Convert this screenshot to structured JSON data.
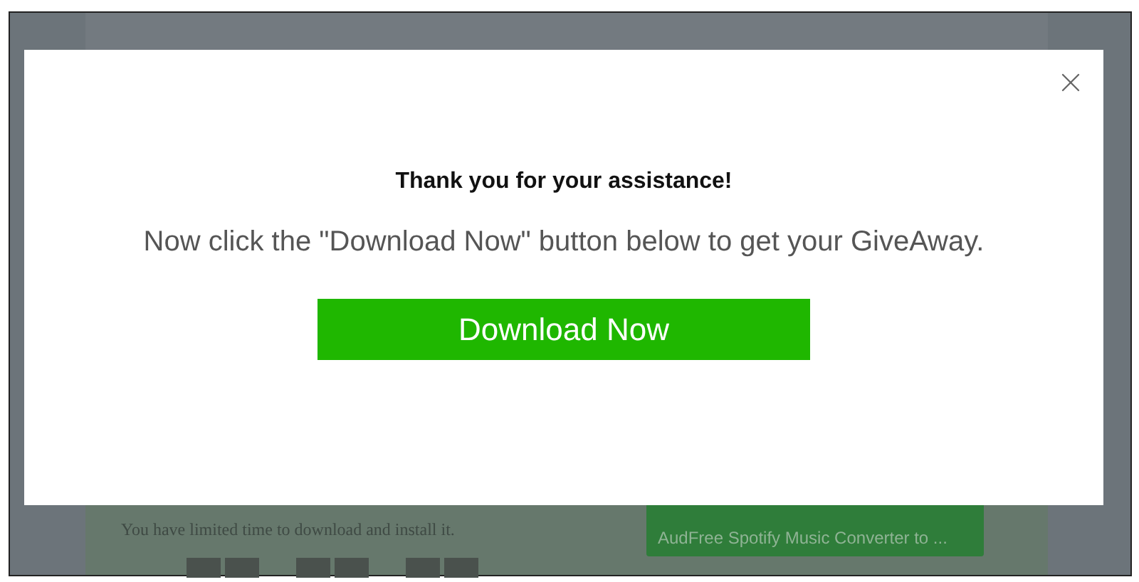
{
  "background_page": {
    "time_notice": "You have limited time to download and install it.",
    "download_button": {
      "sublabel": "AudFree Spotify Music Converter to ..."
    }
  },
  "modal": {
    "title": "Thank you for your assistance!",
    "message": "Now click the \"Download Now\" button below to get your GiveAway.",
    "button": "Download Now"
  }
}
